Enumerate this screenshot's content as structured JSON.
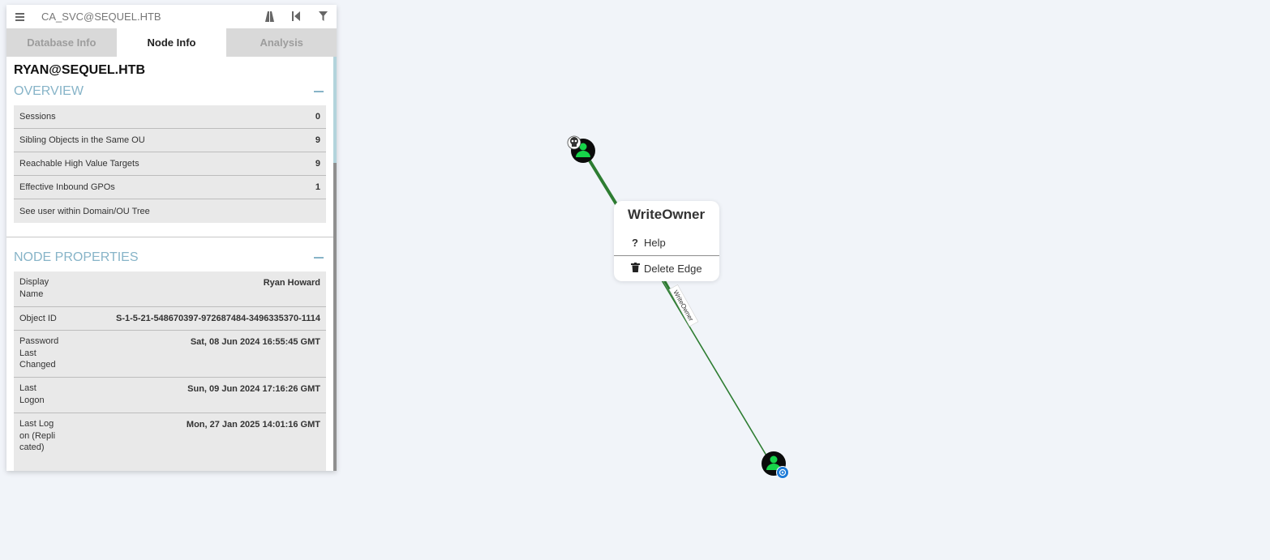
{
  "search": {
    "value": "CA_SVC@SEQUEL.HTB"
  },
  "tabs": [
    {
      "label": "Database Info"
    },
    {
      "label": "Node Info"
    },
    {
      "label": "Analysis"
    }
  ],
  "node": {
    "name": "RYAN@SEQUEL.HTB"
  },
  "overview": {
    "title": "OVERVIEW",
    "rows": [
      {
        "label": "Sessions",
        "value": "0"
      },
      {
        "label": "Sibling Objects in the Same OU",
        "value": "9"
      },
      {
        "label": "Reachable High Value Targets",
        "value": "9"
      },
      {
        "label": "Effective Inbound GPOs",
        "value": "1"
      },
      {
        "label": "See user within Domain/OU Tree",
        "value": ""
      }
    ]
  },
  "properties": {
    "title": "NODE PROPERTIES",
    "rows": [
      {
        "label": "Display Name",
        "value": "Ryan Howard"
      },
      {
        "label": "Object ID",
        "value": "S-1-5-21-548670397-972687484-3496335370-1114"
      },
      {
        "label": "Password Last Changed",
        "value": "Sat, 08 Jun 2024 16:55:45 GMT"
      },
      {
        "label": "Last Logon",
        "value": "Sun, 09 Jun 2024 17:16:26 GMT"
      },
      {
        "label": "Last Logon (Replicated)",
        "value": "Mon, 27 Jan 2025 14:01:16 GMT"
      }
    ]
  },
  "graph": {
    "edge_label": "WriteOwner",
    "edge_color": "#2e7d32",
    "node_color": "#17d44a"
  },
  "context_menu": {
    "title": "WriteOwner",
    "help": "Help",
    "delete": "Delete Edge"
  }
}
